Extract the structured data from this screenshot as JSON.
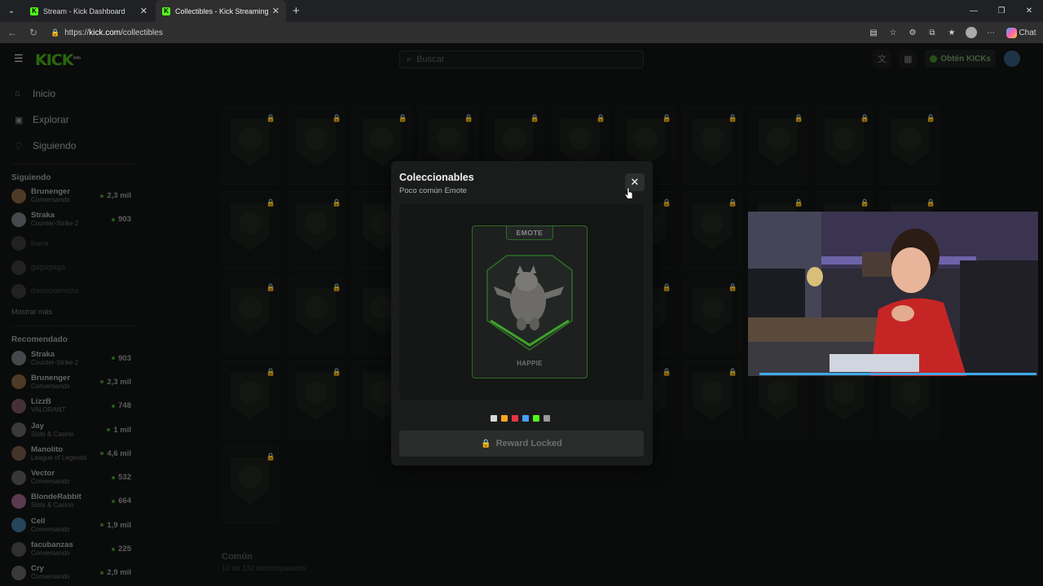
{
  "browser": {
    "tabs": [
      {
        "title": "Stream - Kick Dashboard",
        "active": false
      },
      {
        "title": "Collectibles - Kick Streaming",
        "active": true
      }
    ],
    "url_prefix": "https://",
    "url_domain": "kick.com",
    "url_path": "/collectibles",
    "chat_label": "Chat"
  },
  "topnav": {
    "logo": "KICK",
    "logo_badge": "beta",
    "search_placeholder": "Buscar",
    "kicks_label": "Obtén KICKs"
  },
  "sidebar": {
    "links": [
      {
        "label": "Inicio",
        "icon": "home-icon"
      },
      {
        "label": "Explorar",
        "icon": "compass-icon"
      },
      {
        "label": "Siguiendo",
        "icon": "heart-icon"
      }
    ],
    "following_header": "Siguiendo",
    "following": [
      {
        "name": "Brunenger",
        "category": "Conversando",
        "viewers": "2,3 mil",
        "online": true,
        "color": "#7a5a3a"
      },
      {
        "name": "Straka",
        "category": "Counter-Strike 2",
        "viewers": "903",
        "online": true,
        "color": "#6d6f73"
      },
      {
        "name": "ibera",
        "category": "",
        "viewers": "",
        "online": false,
        "color": "#333"
      },
      {
        "name": "gagagaga",
        "category": "",
        "viewers": "",
        "online": false,
        "color": "#333"
      },
      {
        "name": "davooxeneize",
        "category": "",
        "viewers": "",
        "online": false,
        "color": "#333"
      }
    ],
    "show_more": "Mostrar más",
    "recommended_header": "Recomendado",
    "recommended": [
      {
        "name": "Straka",
        "category": "Counter-Strike 2",
        "viewers": "903",
        "color": "#6d6f73"
      },
      {
        "name": "Brunenger",
        "category": "Conversando",
        "viewers": "2,3 mil",
        "color": "#7a5a3a"
      },
      {
        "name": "LizzB",
        "category": "VALORANT",
        "viewers": "748",
        "color": "#6a4a5a"
      },
      {
        "name": "Jay",
        "category": "Slots & Casino",
        "viewers": "1 mil",
        "color": "#5a5a5a"
      },
      {
        "name": "Manolito",
        "category": "League of Legends",
        "viewers": "4,6 mil",
        "color": "#6a5040"
      },
      {
        "name": "Vector",
        "category": "Conversando",
        "viewers": "532",
        "color": "#555"
      },
      {
        "name": "BlondeRabbit",
        "category": "Slots & Casino",
        "viewers": "664",
        "color": "#8a5a7a"
      },
      {
        "name": "Cell",
        "category": "Conversando",
        "viewers": "1,9 mil",
        "color": "#3a6a8a"
      },
      {
        "name": "facubanzas",
        "category": "Conversando",
        "viewers": "225",
        "color": "#4a4a4a"
      },
      {
        "name": "Cry",
        "category": "Conversando",
        "viewers": "2,9 mil",
        "color": "#5a5a5a"
      }
    ]
  },
  "collectibles": {
    "section_title": "Común",
    "section_progress": "13 de 132 desbloqueados"
  },
  "modal": {
    "title": "Coleccionables",
    "subtitle": "Poco común Emote",
    "card_tag": "EMOTE",
    "emote_name": "HAPPIE",
    "swatch_colors": [
      "#d8d8d8",
      "#f5a623",
      "#e8334a",
      "#4a9ff5",
      "#53fc18",
      "#9a9a9a"
    ],
    "button_label": "Reward Locked"
  },
  "colors": {
    "brand": "#53fc18",
    "rarity_border": "#2e6b26"
  }
}
